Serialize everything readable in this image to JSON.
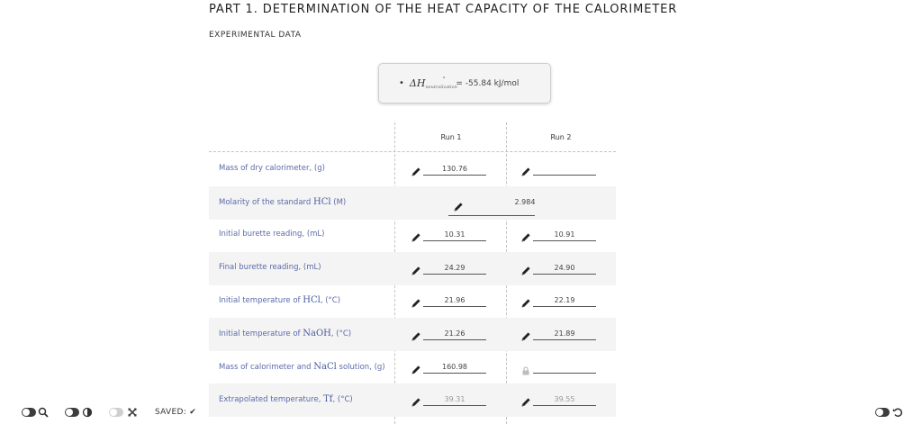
{
  "header": {
    "title": "PART 1. DETERMINATION OF THE HEAT CAPACITY OF THE CALORIMETER",
    "subtitle": "EXPERIMENTAL DATA"
  },
  "constant": {
    "symbol": "ΔH",
    "superscript": "°",
    "subscript": "neutralization",
    "value": "= -55.84 kJ/mol"
  },
  "columns": [
    "Run 1",
    "Run 2"
  ],
  "rows": [
    {
      "prefix": "Mass of dry calorimeter, (g)",
      "math": "",
      "suffix": "",
      "run1": "130.76",
      "run2": ""
    },
    {
      "prefix": "Molarity of the standard ",
      "math": "HCl",
      "suffix": " (M)",
      "shared": "2.984"
    },
    {
      "prefix": "Initial burette reading, (mL)",
      "math": "",
      "suffix": "",
      "run1": "10.31",
      "run2": "10.91"
    },
    {
      "prefix": "Final burette reading, (mL)",
      "math": "",
      "suffix": "",
      "run1": "24.29",
      "run2": "24.90"
    },
    {
      "prefix": "Initial temperature of ",
      "math": "HCl",
      "suffix": ", (°C)",
      "run1": "21.96",
      "run2": "22.19"
    },
    {
      "prefix": "Initial temperature of ",
      "math": "NaOH",
      "suffix": ", (°C)",
      "run1": "21.26",
      "run2": "21.89"
    },
    {
      "prefix": "Mass of calorimeter and ",
      "math": "NaCl",
      "suffix": " solution, (g)",
      "run1": "160.98",
      "run2": ""
    },
    {
      "prefix": "Extrapolated temperature, ",
      "math": "Tf",
      "suffix": ", (°C)",
      "run1": "39.31",
      "run2": "39.55"
    }
  ],
  "footer": {
    "saved_label": "SAVED:",
    "saved_check": "✔"
  },
  "icons": {
    "pencil": "pencil-icon",
    "lock": "lock-icon",
    "zoom": "zoom-icon",
    "contrast": "contrast-icon",
    "close": "close-icon",
    "undo": "undo-icon"
  }
}
